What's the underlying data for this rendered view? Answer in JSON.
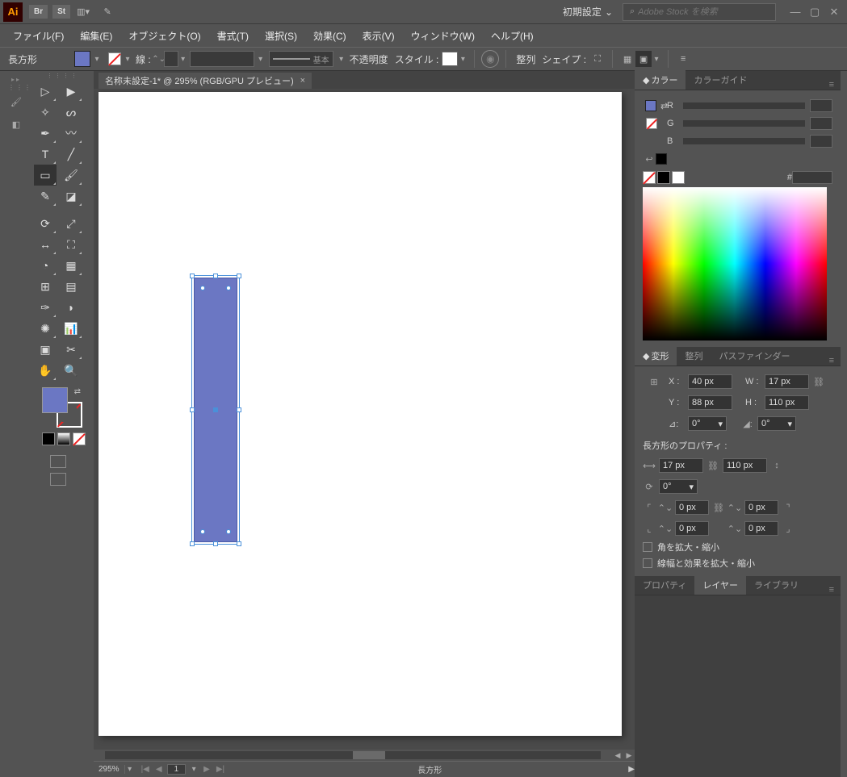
{
  "titlebar": {
    "logo": "Ai",
    "br": "Br",
    "st": "St",
    "preset": "初期設定",
    "search_placeholder": "Adobe Stock を検索"
  },
  "menubar": {
    "file": "ファイル(F)",
    "edit": "編集(E)",
    "object": "オブジェクト(O)",
    "type": "書式(T)",
    "select": "選択(S)",
    "effect": "効果(C)",
    "view": "表示(V)",
    "window": "ウィンドウ(W)",
    "help": "ヘルプ(H)"
  },
  "ctrlbar": {
    "selection": "長方形",
    "stroke_label": "線 :",
    "brush_basic": "基本",
    "opacity_label": "不透明度",
    "style_label": "スタイル :",
    "align_label": "整列",
    "shape_label": "シェイプ :"
  },
  "doc": {
    "tab_title": "名称未設定-1* @ 295% (RGB/GPU プレビュー)",
    "tab_close": "×",
    "zoom": "295%",
    "page": "1",
    "status_sel": "長方形"
  },
  "panels": {
    "color_tab": "カラー",
    "colorguide_tab": "カラーガイド",
    "r": "R",
    "g": "G",
    "b": "B",
    "hex": "#",
    "transform_tab": "変形",
    "align_tab": "整列",
    "pathfinder_tab": "パスファインダー",
    "x_lab": "X :",
    "y_lab": "Y :",
    "w_lab": "W :",
    "h_lab": "H :",
    "x_val": "40 px",
    "y_val": "88 px",
    "w_val": "17 px",
    "h_val": "110 px",
    "angle_lab": "⊿:",
    "angle_val": "0°",
    "shear_val": "0°",
    "rectprops": "長方形のプロパティ :",
    "rw": "17 px",
    "rh": "110 px",
    "rot": "0°",
    "c_tl": "0 px",
    "c_tr": "0 px",
    "c_bl": "0 px",
    "c_br": "0 px",
    "scale_corners": "角を拡大・縮小",
    "scale_strokes": "線幅と効果を拡大・縮小",
    "props_tab": "プロパティ",
    "layers_tab": "レイヤー",
    "libs_tab": "ライブラリ"
  }
}
